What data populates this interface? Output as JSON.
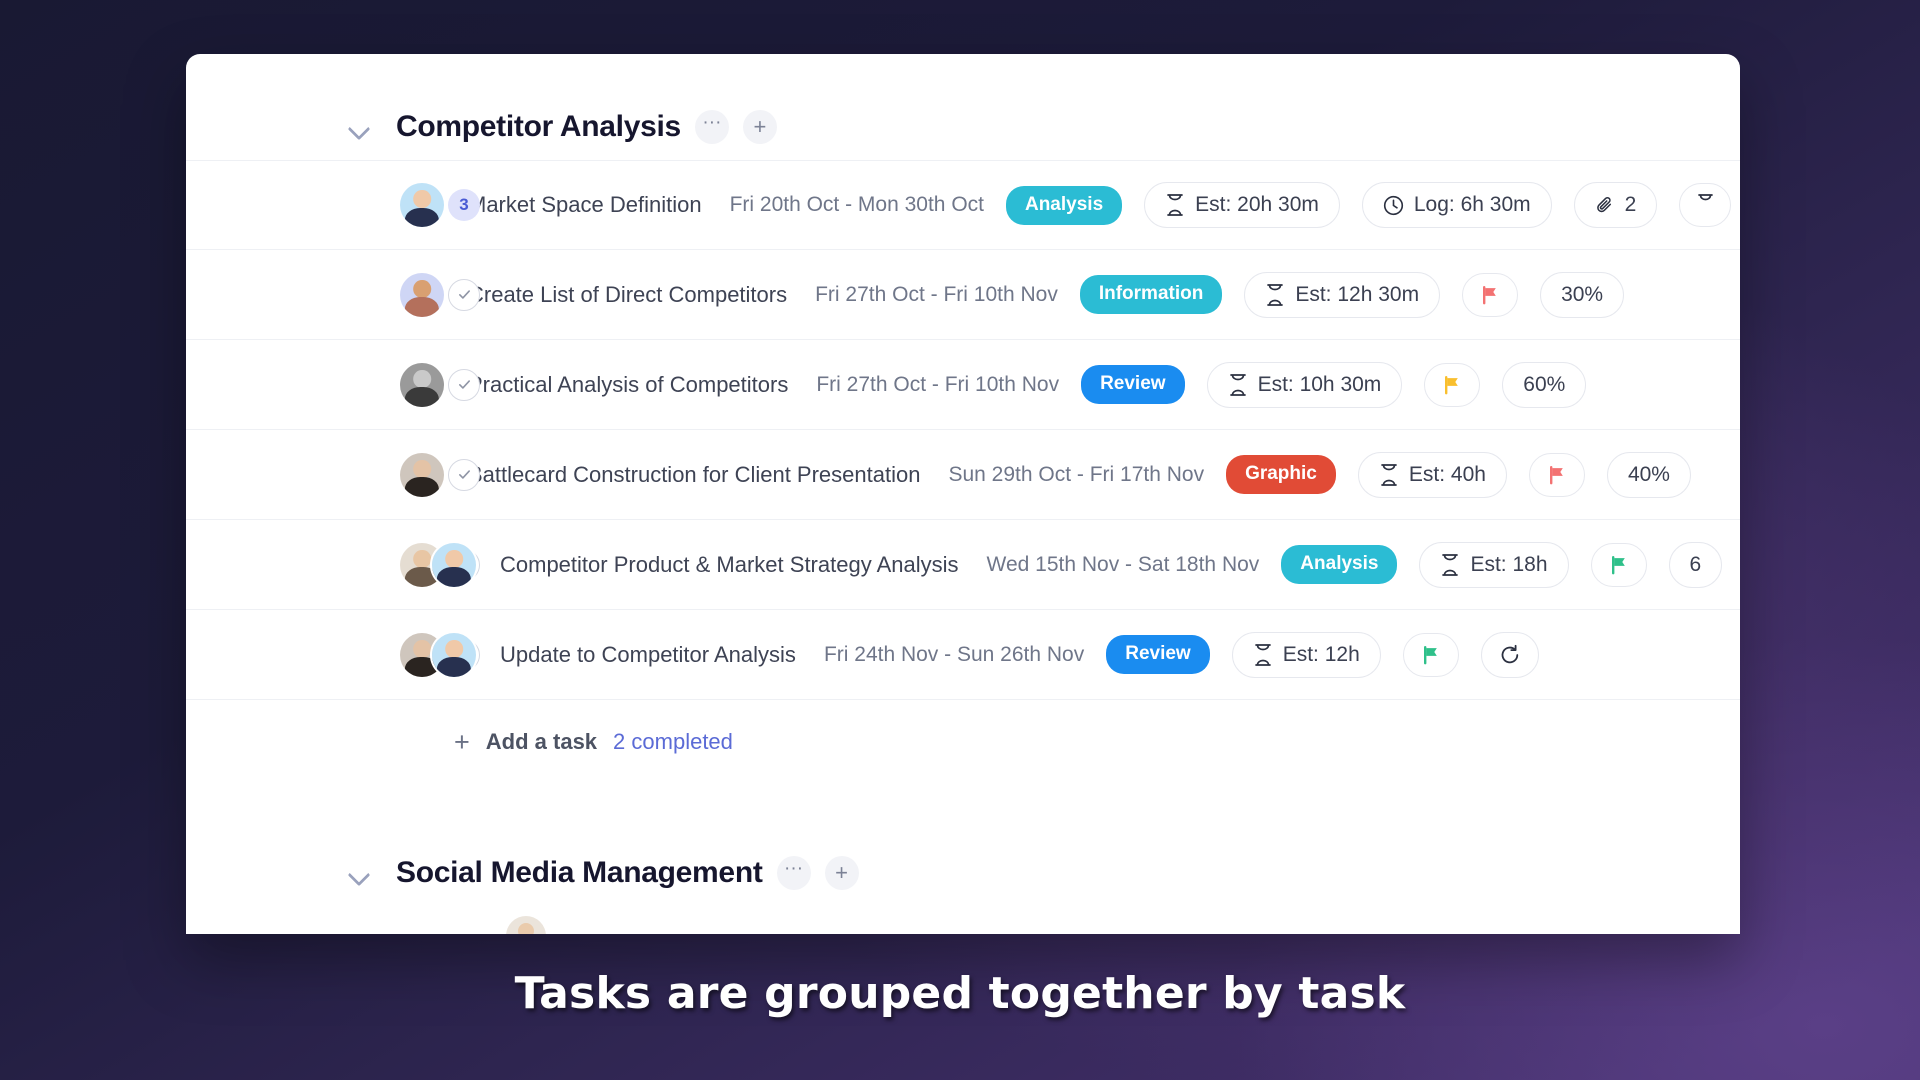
{
  "caption": "Tasks are grouped together by task",
  "colors": {
    "tag_analysis": "#2bbcd4",
    "tag_information": "#2bbcd4",
    "tag_review": "#1a8cf0",
    "tag_graphic": "#e14b36",
    "flag_red": "#f37272",
    "flag_yellow": "#f9bf2e",
    "flag_green": "#2fc08a",
    "link_blue": "#5b6bd6",
    "subcount_bg": "#dfe2fb"
  },
  "groups": [
    {
      "title": "Competitor Analysis",
      "more_label": "···",
      "add_label": "+",
      "footer": {
        "add_task": "Add a task",
        "completed": "2 completed",
        "plus": "+"
      },
      "tasks": [
        {
          "kind": "parent",
          "subtask_count": "3",
          "name": "Market Space Definition",
          "dates": "Fri 20th Oct - Mon 30th Oct",
          "tag": "Analysis",
          "tag_color": "#2bbcd4",
          "estimate": "Est: 20h 30m",
          "logged": "Log: 6h 30m",
          "attachments": "2",
          "avatars": [
            {
              "bg": "#bfe2f7",
              "head": "#f0c9a8",
              "body": "#27304f",
              "hair": "#e8d79a"
            }
          ]
        },
        {
          "kind": "child",
          "name": "Create List of Direct Competitors",
          "dates": "Fri 27th Oct - Fri 10th Nov",
          "tag": "Information",
          "tag_color": "#2bbcd4",
          "estimate": "Est: 12h 30m",
          "flag": "red",
          "progress": "30%",
          "avatars": [
            {
              "bg": "#cfd6f5",
              "head": "#d9a071",
              "body": "#b4705c",
              "hair": "#3a2a22"
            }
          ]
        },
        {
          "kind": "child",
          "name": "Practical Analysis of Competitors",
          "dates": "Fri 27th Oct - Fri 10th Nov",
          "tag": "Review",
          "tag_color": "#1a8cf0",
          "estimate": "Est: 10h 30m",
          "flag": "yellow",
          "progress": "60%",
          "avatars": [
            {
              "bg": "#9a9a9a",
              "head": "#c9c9c9",
              "body": "#3a3a3a",
              "hair": "#2b2b2b"
            }
          ]
        },
        {
          "kind": "child",
          "name": "Battlecard Construction for Client Presentation",
          "dates": "Sun 29th Oct - Fri 17th Nov",
          "tag": "Graphic",
          "tag_color": "#e14b36",
          "estimate": "Est: 40h",
          "flag": "red",
          "progress": "40%",
          "avatars": [
            {
              "bg": "#cfc6bd",
              "head": "#e4c3a6",
              "body": "#2a2420",
              "hair": "#1d1815"
            }
          ]
        },
        {
          "kind": "child",
          "name": "Competitor Product & Market Strategy Analysis",
          "dates": "Wed 15th Nov - Sat 18th Nov",
          "tag": "Analysis",
          "tag_color": "#2bbcd4",
          "estimate": "Est: 18h",
          "flag": "green",
          "progress": "6",
          "progress_clipped": true,
          "avatars": [
            {
              "bg": "#e5ddd2",
              "head": "#e8c6a4",
              "body": "#6b5a4a",
              "hair": "#c8a878"
            },
            {
              "bg": "#bfe2f7",
              "head": "#f0c9a8",
              "body": "#27304f",
              "hair": "#e8d79a"
            }
          ]
        },
        {
          "kind": "child",
          "name": "Update to Competitor Analysis",
          "dates": "Fri 24th Nov - Sun 26th Nov",
          "tag": "Review",
          "tag_color": "#1a8cf0",
          "estimate": "Est: 12h",
          "flag": "green",
          "recurring": true,
          "avatars": [
            {
              "bg": "#cfc6bd",
              "head": "#e4c3a6",
              "body": "#2a2420",
              "hair": "#1d1815"
            },
            {
              "bg": "#bfe2f7",
              "head": "#f0c9a8",
              "body": "#27304f",
              "hair": "#e8d79a"
            }
          ]
        }
      ]
    },
    {
      "title": "Social Media Management",
      "more_label": "···",
      "add_label": "+",
      "tasks": []
    }
  ],
  "icons": {
    "hourglass": "hourglass-icon",
    "clock": "clock-icon",
    "paperclip": "paperclip-icon",
    "flag": "flag-icon",
    "recurring": "recurring-icon",
    "check": "check-icon",
    "chevron_down": "chevron-down-icon",
    "chevron_right": "chevron-right-icon"
  }
}
